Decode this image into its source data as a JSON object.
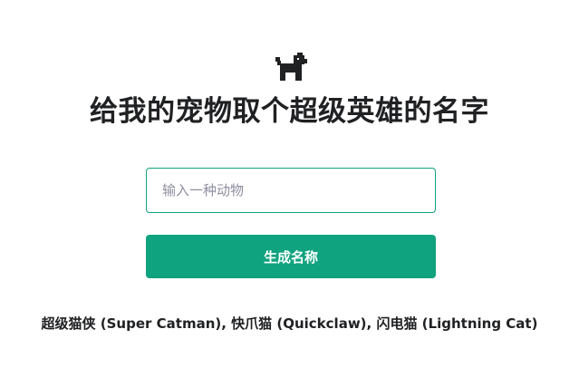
{
  "logo": {
    "icon": "dog-icon",
    "color": "#202123"
  },
  "header": {
    "title": "给我的宠物取个超级英雄的名字"
  },
  "form": {
    "animal_input": {
      "value": "",
      "placeholder": "输入一种动物"
    },
    "submit_label": "生成名称"
  },
  "result": {
    "text": "超级猫侠 (Super Catman), 快爪猫 (Quickclaw), 闪电猫 (Lightning Cat)"
  },
  "colors": {
    "accent": "#10a37f",
    "text": "#202123",
    "placeholder": "#8e8ea0",
    "background": "#ffffff"
  }
}
